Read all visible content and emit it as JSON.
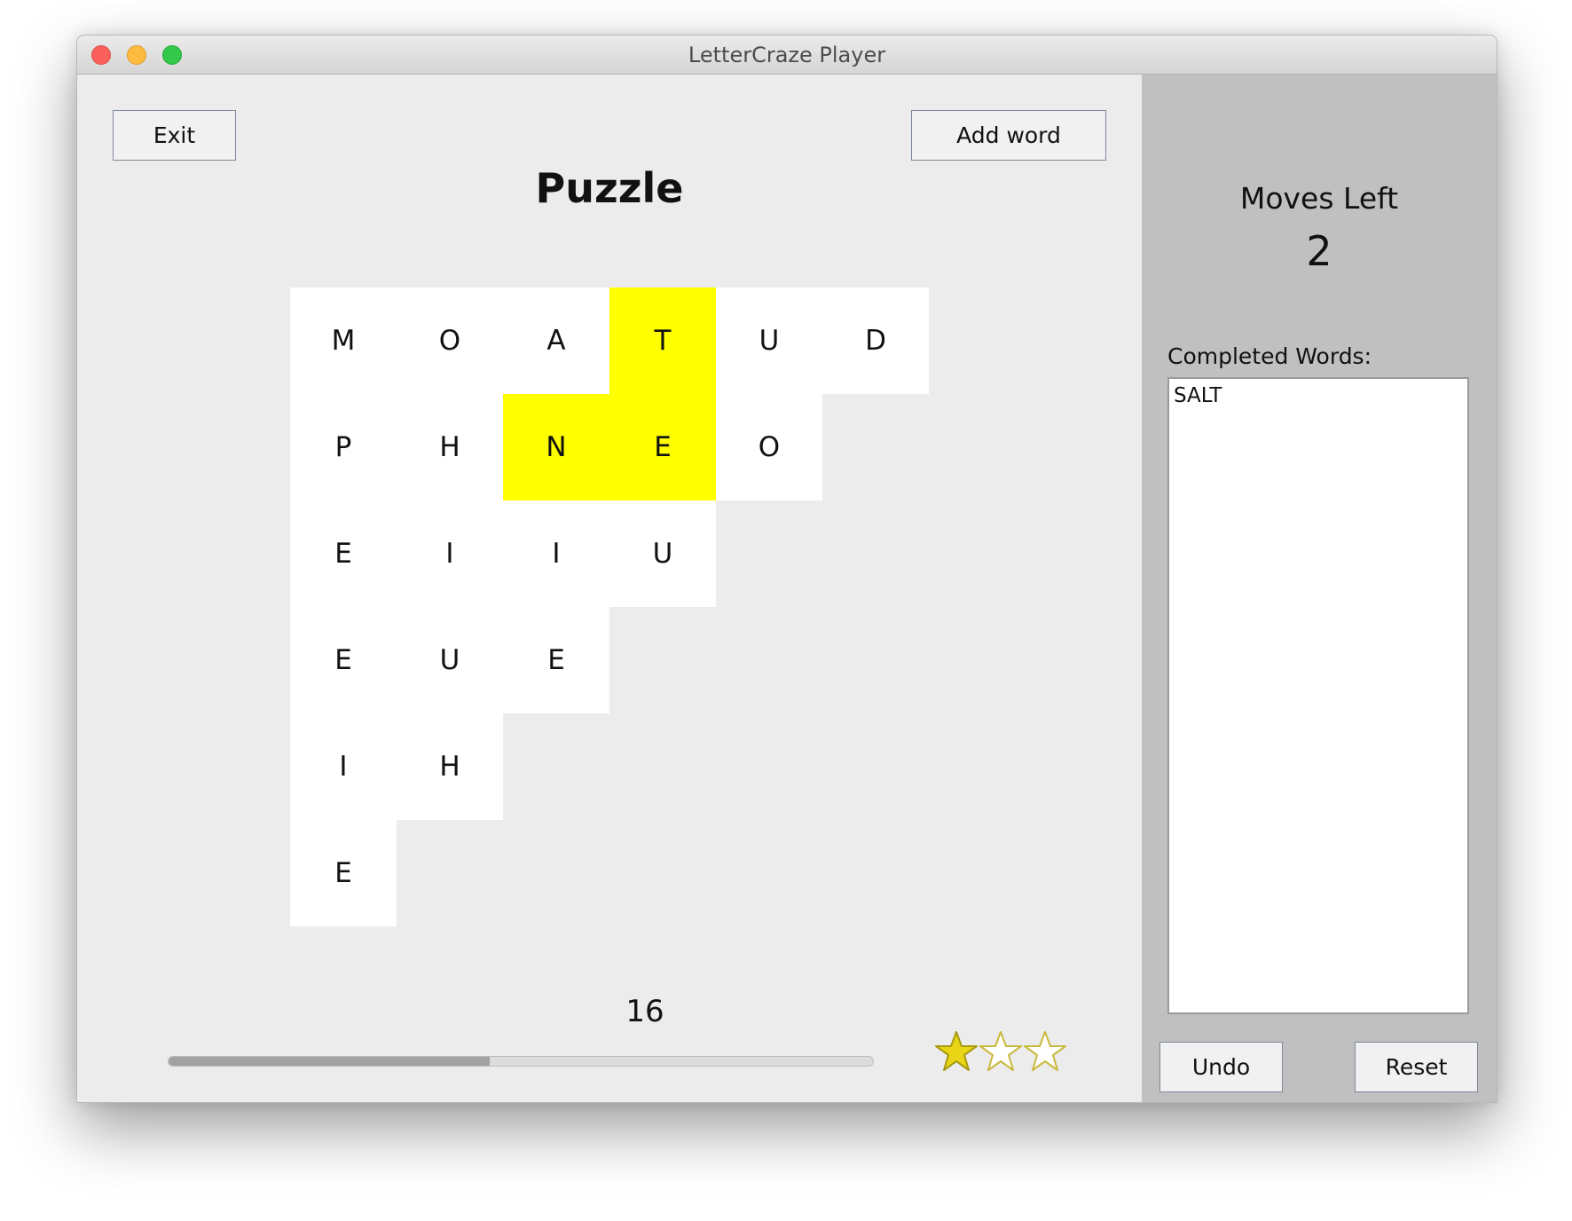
{
  "window": {
    "title": "LetterCraze Player"
  },
  "toolbar": {
    "exit_label": "Exit",
    "add_word_label": "Add word"
  },
  "puzzle": {
    "title": "Puzzle",
    "highlight_color": "#ffff00",
    "grid": [
      [
        "M",
        "O",
        "A",
        "T",
        "U",
        "D"
      ],
      [
        "P",
        "H",
        "N",
        "E",
        "O",
        null
      ],
      [
        "E",
        "I",
        "I",
        "U",
        null,
        null
      ],
      [
        "E",
        "U",
        "E",
        null,
        null,
        null
      ],
      [
        "I",
        "H",
        null,
        null,
        null,
        null
      ],
      [
        "E",
        null,
        null,
        null,
        null,
        null
      ]
    ],
    "selected": [
      [
        0,
        3
      ],
      [
        1,
        2
      ],
      [
        1,
        3
      ]
    ]
  },
  "score": {
    "value": "16",
    "progress_fraction": 0.456
  },
  "stars": {
    "total": 3,
    "earned": 1
  },
  "sidebar": {
    "moves_label": "Moves Left",
    "moves_value": "2",
    "completed_label": "Completed Words:",
    "completed_words": [
      "SALT"
    ],
    "undo_label": "Undo",
    "reset_label": "Reset"
  }
}
